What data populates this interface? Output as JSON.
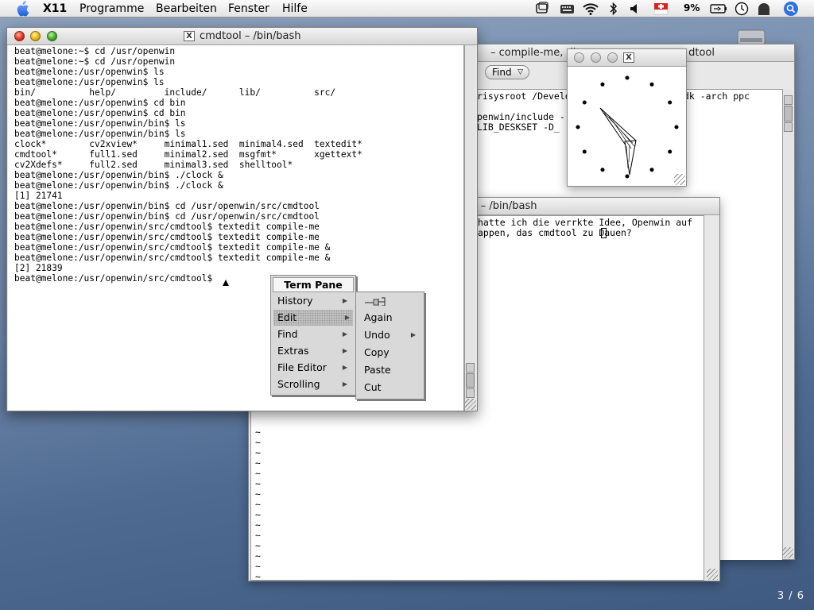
{
  "menubar": {
    "apple_icon": "apple-logo-icon",
    "app_name": "X11",
    "items": [
      "Programme",
      "Bearbeiten",
      "Fenster",
      "Hilfe"
    ],
    "battery_percent": "9%",
    "tray_icons": [
      "screen-mirroring-icon",
      "keyboard-icon",
      "wifi-icon",
      "bluetooth-icon",
      "volume-icon",
      "swiss-flag-icon",
      "battery-icon",
      "clock-icon",
      "user-icon",
      "spotlight-icon"
    ]
  },
  "compile_window": {
    "title": "– compile-me, di",
    "title_right": "dtool",
    "find_button": "Find",
    "line1": "risysroot /Develo",
    "line1_right": "sdk -arch ppc",
    "line2": "penwin/include -",
    "line3": "LIB_DESKSET -D_"
  },
  "textedit_window": {
    "title": "l – /bin/bash",
    "text_lines": [
      "hatte ich die verrkte Idee, Openwin auf",
      "appen, das cmdtool zu Dauen?"
    ],
    "tilde_count": 15,
    "tilde_char": "~"
  },
  "clock_window": {
    "icon": "x11-icon",
    "hour_markers": 12
  },
  "cmdtool": {
    "title": "cmdtool – /bin/bash",
    "title_icon": "x11-icon",
    "lines": [
      "beat@melone:~$ cd /usr/openwin",
      "beat@melone:~$ cd /usr/openwin",
      "beat@melone:/usr/openwin$ ls",
      "beat@melone:/usr/openwin$ ls",
      "bin/          help/         include/      lib/          src/",
      "beat@melone:/usr/openwin$ cd bin",
      "beat@melone:/usr/openwin$ cd bin",
      "beat@melone:/usr/openwin/bin$ ls",
      "beat@melone:/usr/openwin/bin$ ls",
      "clock*        cv2xview*     minimal1.sed  minimal4.sed  textedit*",
      "cmdtool*      full1.sed     minimal2.sed  msgfmt*       xgettext*",
      "cv2Xdefs*     full2.sed     minimal3.sed  shelltool*",
      "beat@melone:/usr/openwin/bin$ ./clock &",
      "beat@melone:/usr/openwin/bin$ ./clock &",
      "[1] 21741",
      "beat@melone:/usr/openwin/bin$ cd /usr/openwin/src/cmdtool",
      "beat@melone:/usr/openwin/bin$ cd /usr/openwin/src/cmdtool",
      "beat@melone:/usr/openwin/src/cmdtool$ textedit compile-me",
      "beat@melone:/usr/openwin/src/cmdtool$ textedit compile-me",
      "beat@melone:/usr/openwin/src/cmdtool$ textedit compile-me &",
      "beat@melone:/usr/openwin/src/cmdtool$ textedit compile-me &",
      "[2] 21839",
      "beat@melone:/usr/openwin/src/cmdtool$"
    ]
  },
  "term_pane_menu": {
    "title": "Term Pane",
    "items": [
      {
        "label": "History",
        "submenu": true
      },
      {
        "label": "Edit",
        "submenu": true,
        "highlighted": true
      },
      {
        "label": "Find",
        "submenu": true
      },
      {
        "label": "Extras",
        "submenu": true
      },
      {
        "label": "File Editor",
        "submenu": true
      },
      {
        "label": "Scrolling",
        "submenu": true
      }
    ]
  },
  "edit_submenu": {
    "pin_icon": "pushpin-icon",
    "items": [
      {
        "label": "Again",
        "submenu": false
      },
      {
        "label": "Undo",
        "submenu": true
      },
      {
        "label": "Copy",
        "submenu": false
      },
      {
        "label": "Paste",
        "submenu": false
      },
      {
        "label": "Cut",
        "submenu": false
      }
    ]
  },
  "desktop": {
    "page_indicator": "3 / 6",
    "disk_icon": "hard-disk-icon"
  }
}
